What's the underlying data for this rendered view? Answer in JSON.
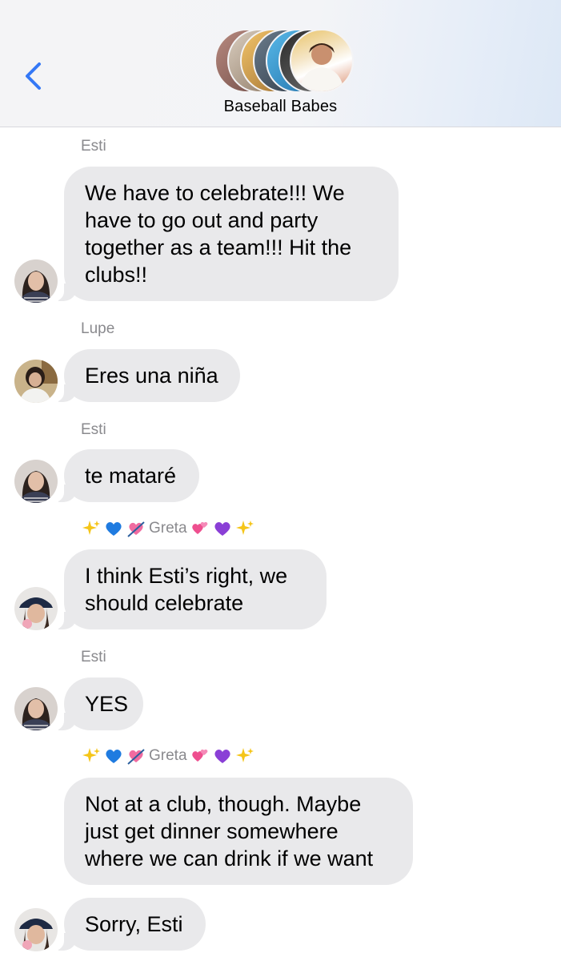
{
  "header": {
    "group_name": "Baseball Babes",
    "back_icon": "chevron-left-icon",
    "accent_color": "#3478f6"
  },
  "messages": [
    {
      "sender": "Esti",
      "text": "We have to celebrate!!! We have to go out and party together as a team!!! Hit the clubs!!"
    },
    {
      "sender": "Lupe",
      "text": "Eres una niña"
    },
    {
      "sender": "Esti",
      "text": "te mataré"
    },
    {
      "sender": "Greta",
      "sender_decor_left": [
        "sparkles",
        "blue-heart",
        "heart-with-arrow"
      ],
      "sender_decor_right": [
        "two-hearts",
        "purple-heart",
        "sparkles"
      ],
      "text": "I think Esti’s right, we should celebrate"
    },
    {
      "sender": "Esti",
      "text": "YES"
    },
    {
      "sender": "Greta",
      "sender_decor_left": [
        "sparkles",
        "blue-heart",
        "heart-with-arrow"
      ],
      "sender_decor_right": [
        "two-hearts",
        "purple-heart",
        "sparkles"
      ],
      "text": "Not at a club, though. Maybe just get dinner somewhere where we can drink if we want"
    },
    {
      "text": "Sorry, Esti"
    }
  ],
  "colors": {
    "bubble_incoming": "#e9e9eb",
    "sender_label": "#8a8a8e"
  }
}
